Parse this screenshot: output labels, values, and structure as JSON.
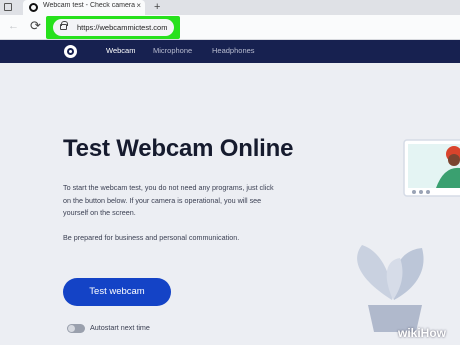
{
  "browser": {
    "tab_title": "Webcam test - Check camera on",
    "tab_close": "×",
    "new_tab": "+",
    "back": "←",
    "refresh": "⟳",
    "url": "https://webcammictest.com"
  },
  "nav": {
    "items": [
      {
        "label": "Webcam"
      },
      {
        "label": "Microphone"
      },
      {
        "label": "Headphones"
      }
    ]
  },
  "main": {
    "title": "Test Webcam Online",
    "paragraph1": "To start the webcam test, you do not need any programs, just click on the button below. If your camera is operational, you will see yourself on the screen.",
    "paragraph2": "Be prepared for business and personal communication.",
    "button_label": "Test webcam",
    "autostart_label": "Autostart next time"
  },
  "watermark": "wikiHow",
  "colors": {
    "nav_bg": "#172150",
    "button": "#1443c6",
    "highlight": "#27e11c",
    "page_bg": "#eceef3",
    "title": "#161b2e"
  },
  "icons": {
    "tab": "tab-actions-icon",
    "favicon": "site-favicon-icon",
    "lock": "lock-icon",
    "logo": "site-logo-icon"
  }
}
